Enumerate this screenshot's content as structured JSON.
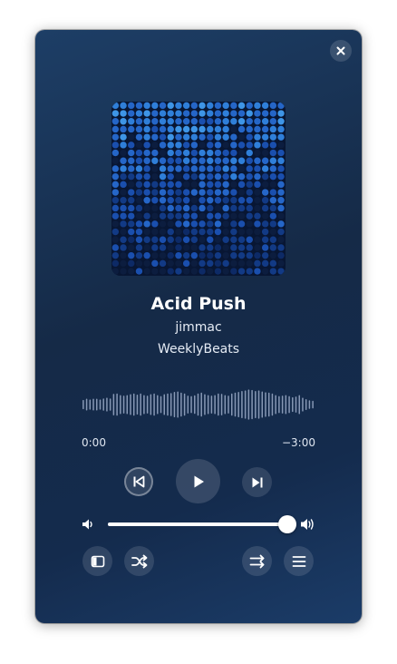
{
  "window": {
    "close_icon": "close-icon"
  },
  "track": {
    "cover_art": "album-cover-art",
    "title": "Acid Push",
    "artist": "jimmac",
    "album": "WeeklyBeats"
  },
  "progress": {
    "elapsed": "0:00",
    "remaining": "−3:00",
    "fraction": 0.0
  },
  "waveform": {
    "peaks": [
      0.3,
      0.38,
      0.33,
      0.38,
      0.38,
      0.33,
      0.4,
      0.45,
      0.4,
      0.7,
      0.72,
      0.62,
      0.58,
      0.62,
      0.68,
      0.72,
      0.65,
      0.72,
      0.62,
      0.58,
      0.68,
      0.72,
      0.62,
      0.55,
      0.68,
      0.72,
      0.75,
      0.82,
      0.85,
      0.78,
      0.72,
      0.58,
      0.55,
      0.6,
      0.72,
      0.78,
      0.68,
      0.62,
      0.58,
      0.62,
      0.72,
      0.7,
      0.62,
      0.58,
      0.72,
      0.78,
      0.82,
      0.88,
      0.92,
      0.98,
      0.95,
      0.88,
      0.92,
      0.85,
      0.8,
      0.78,
      0.72,
      0.62,
      0.55,
      0.58,
      0.62,
      0.55,
      0.48,
      0.52,
      0.62,
      0.45,
      0.35,
      0.28,
      0.25
    ],
    "played_color": "#ffffff",
    "unplayed_color": "#8798b5"
  },
  "controls": {
    "previous_icon": "skip-previous-icon",
    "play_icon": "play-icon",
    "next_icon": "skip-next-icon"
  },
  "volume": {
    "level": 1.0,
    "low_icon": "volume-low-icon",
    "high_icon": "volume-high-icon"
  },
  "bottom_bar": {
    "sidebar_icon": "sidebar-show-icon",
    "shuffle_icon": "shuffle-icon",
    "repeat_icon": "repeat-icon",
    "menu_icon": "hamburger-menu-icon"
  },
  "colors": {
    "background_start": "#1d3e66",
    "background_mid": "#152a47",
    "accent": "#ffffff",
    "cover_dots": [
      "#0d2a66",
      "#123a85",
      "#1a4fae",
      "#2566c8",
      "#2f7fd9",
      "#3e95e6"
    ]
  }
}
